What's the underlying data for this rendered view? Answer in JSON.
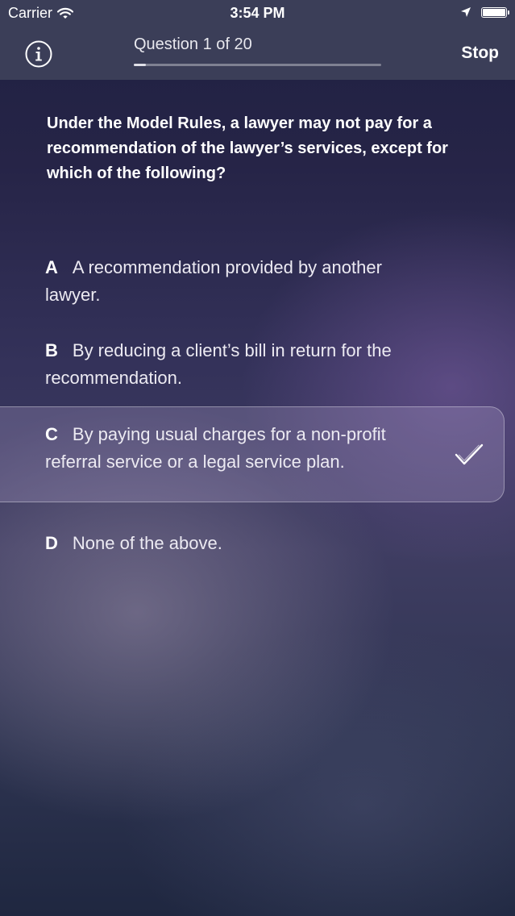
{
  "status_bar": {
    "carrier": "Carrier",
    "time": "3:54 PM",
    "battery_level": 1.0
  },
  "nav": {
    "title": "Question 1 of 20",
    "progress": 0.05,
    "stop_label": "Stop"
  },
  "question": {
    "text": "Under the Model Rules, a lawyer may not pay for a recommendation of the lawyer’s services, except for which of the following?"
  },
  "answers": [
    {
      "letter": "A",
      "text": "A recommendation provided by another lawyer.",
      "selected": false
    },
    {
      "letter": "B",
      "text": "By reducing a client’s bill in return for the recommendation.",
      "selected": false
    },
    {
      "letter": "C",
      "text": "By paying usual charges for a non-profit referral service or a legal service plan.",
      "selected": true
    },
    {
      "letter": "D",
      "text": "None of the above.",
      "selected": false
    }
  ],
  "icons": {
    "info": "info-icon",
    "wifi": "wifi-icon",
    "location": "location-arrow-icon",
    "battery": "battery-icon",
    "check": "checkmark-icon"
  }
}
